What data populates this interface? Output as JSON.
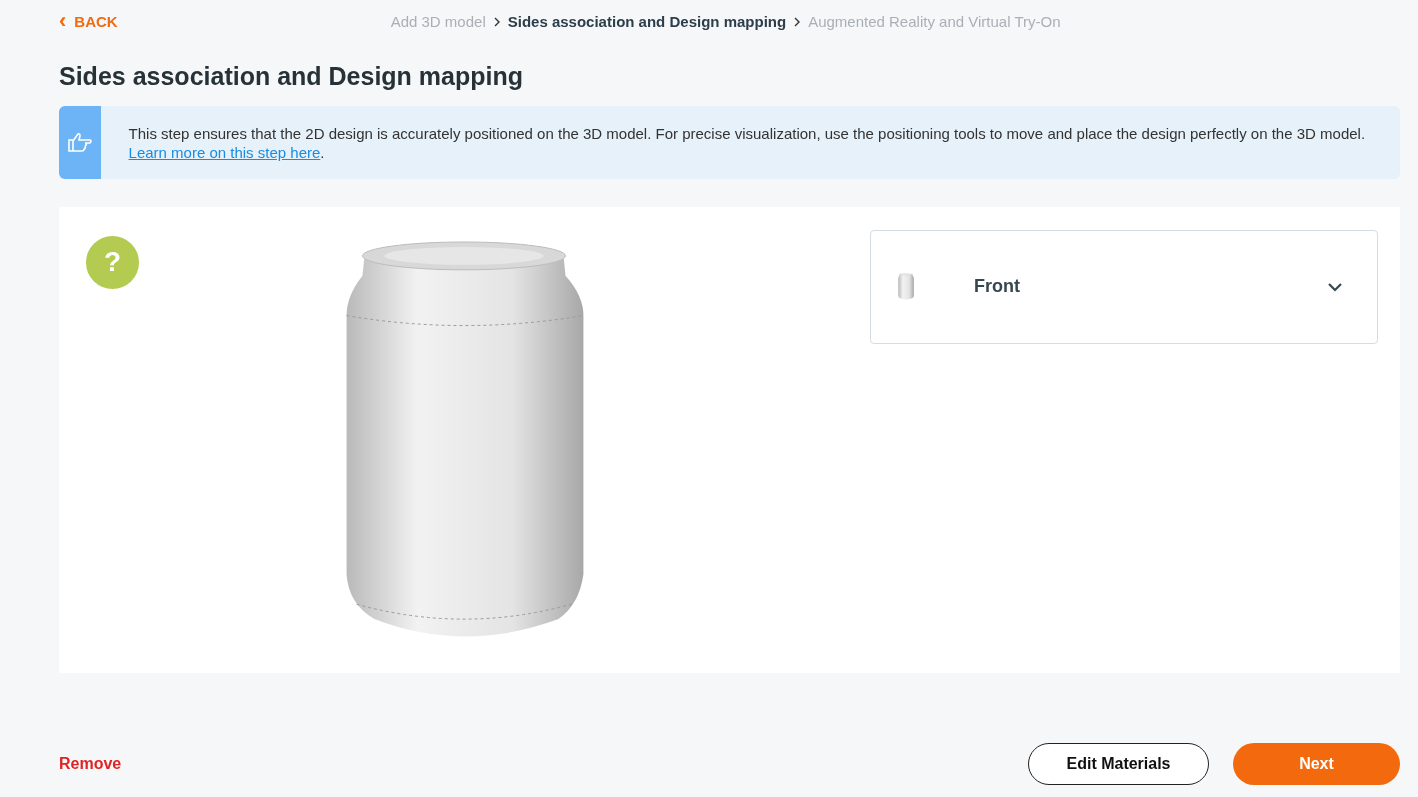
{
  "back": {
    "icon": "‹",
    "label": "BACK"
  },
  "breadcrumb": [
    {
      "label": "Add 3D model",
      "selected": false
    },
    {
      "label": "Sides association and Design mapping",
      "selected": true
    },
    {
      "label": "Augmented Reality and Virtual Try-On",
      "selected": false
    }
  ],
  "title": "Sides association and Design mapping",
  "banner": {
    "text": "This step ensures that the 2D design is accurately positioned on the 3D model. For precise visualization, use the positioning tools to move and place the design perfectly on the 3D model.",
    "link": "Learn more on this step here",
    "after": "."
  },
  "viewer": {
    "help": "?"
  },
  "sides": [
    {
      "label": "Front",
      "expanded": false
    }
  ],
  "footer": {
    "remove": "Remove",
    "edit": "Edit Materials",
    "next": "Next"
  }
}
